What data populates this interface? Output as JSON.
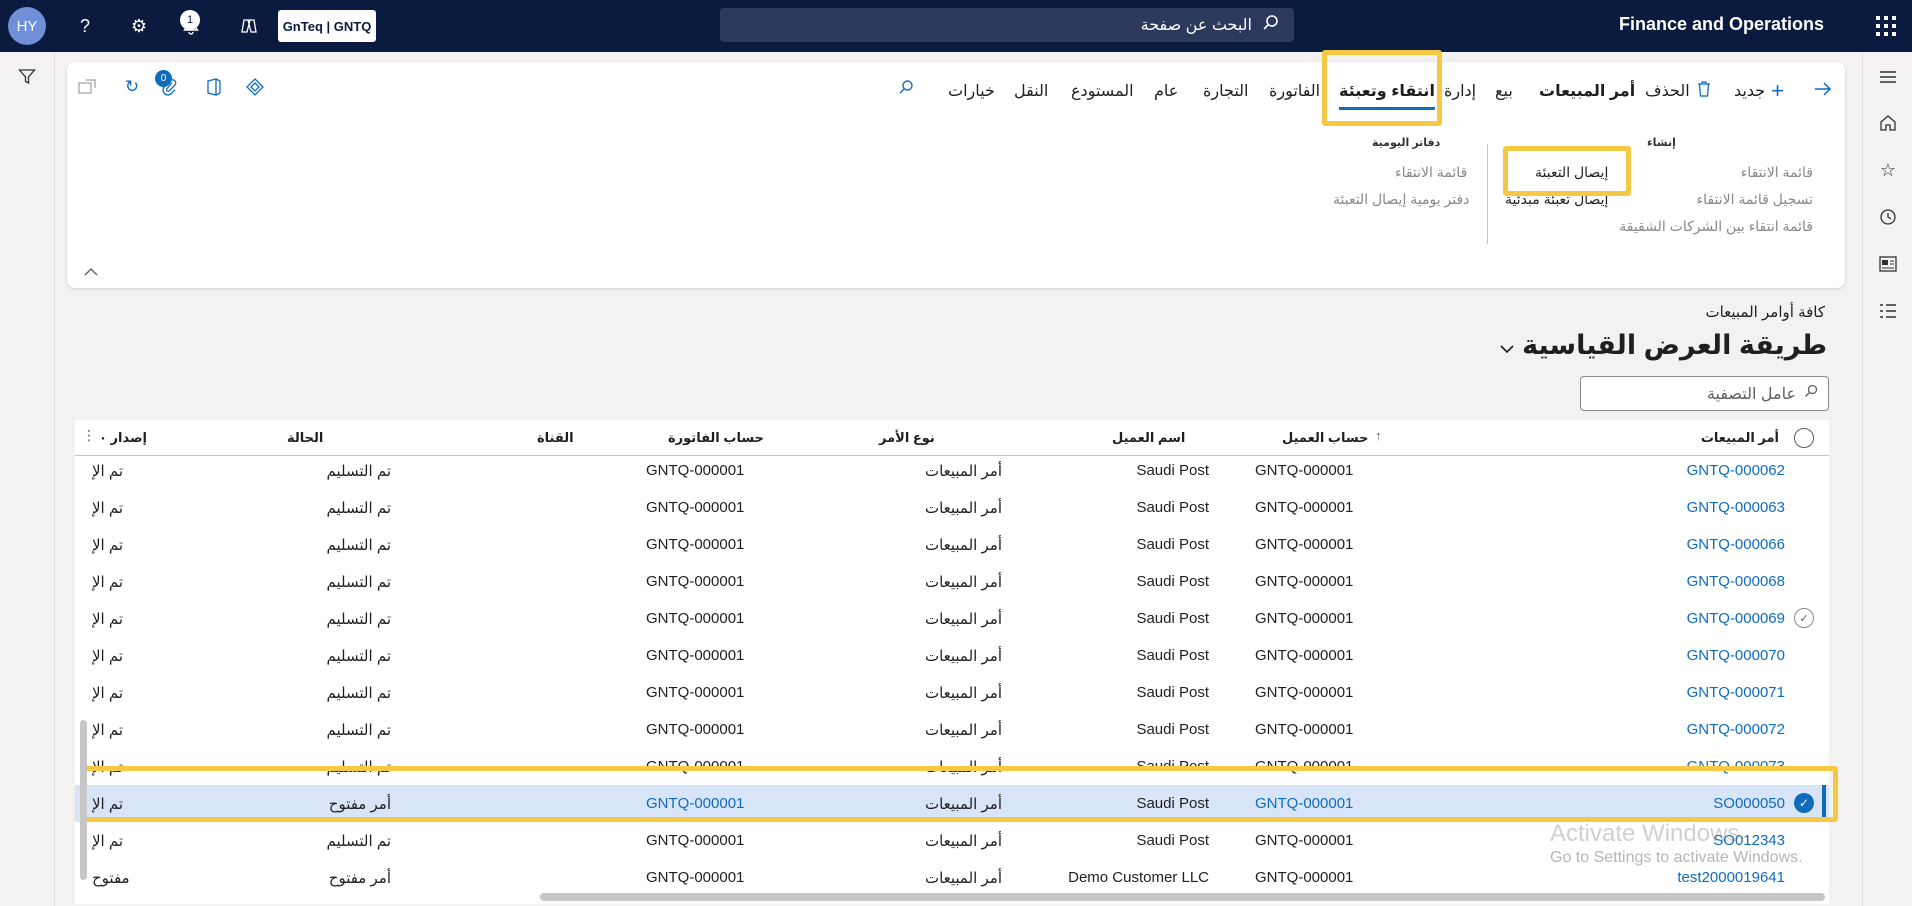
{
  "topbar": {
    "avatar_initials": "HY",
    "help_icon": "?",
    "notification_count": "1",
    "company": "GnTeq | GNTQ",
    "search_placeholder": "البحث عن صفحة",
    "app_title": "Finance and Operations"
  },
  "actionpane": {
    "new_label": "جديد",
    "delete_label": "الحذف",
    "attachments_count": "0",
    "tabs": [
      "أمر المبيعات",
      "بيع",
      "إدارة",
      "انتقاء وتعبئة",
      "الفاتورة",
      "التجارة",
      "عام",
      "المستودع",
      "النقل",
      "خيارات"
    ],
    "active_tab": "انتقاء وتعبئة",
    "groups": [
      {
        "title": "إنشاء",
        "items": [
          {
            "label": "قائمة الانتقاء",
            "enabled": false
          },
          {
            "label": "تسجيل قائمة الانتقاء",
            "enabled": false
          },
          {
            "label": "قائمة انتقاء بين الشركات الشقيقة",
            "enabled": false
          }
        ]
      },
      {
        "title": "",
        "items": [
          {
            "label": "إيصال التعبئة",
            "enabled": true
          },
          {
            "label": "إيصال تعبئة مبدئية",
            "enabled": true
          }
        ]
      },
      {
        "title": "دفاتر اليومية",
        "items": [
          {
            "label": "قائمة الانتقاء",
            "enabled": false
          },
          {
            "label": "دفتر يومية إيصال التعبئة",
            "enabled": false
          }
        ]
      }
    ]
  },
  "page": {
    "breadcrumb": "كافة أوامر المبيعات",
    "view_title": "طريقة العرض القياسية",
    "filter_placeholder": "عامل التصفية"
  },
  "grid": {
    "columns": [
      "أمر المبيعات",
      "حساب العميل",
      "اسم العميل",
      "نوع الأمر",
      "حساب الفاتورة",
      "القناة",
      "الحالة",
      "إصدار ٠"
    ],
    "rows": [
      {
        "order": "GNTQ-000062",
        "account": "GNTQ-000001",
        "name": "Saudi Post",
        "type": "أمر المبيعات",
        "invoice": "GNTQ-000001",
        "channel": "",
        "status": "تم التسليم",
        "release": "تم الإ"
      },
      {
        "order": "GNTQ-000063",
        "account": "GNTQ-000001",
        "name": "Saudi Post",
        "type": "أمر المبيعات",
        "invoice": "GNTQ-000001",
        "channel": "",
        "status": "تم التسليم",
        "release": "تم الإ"
      },
      {
        "order": "GNTQ-000066",
        "account": "GNTQ-000001",
        "name": "Saudi Post",
        "type": "أمر المبيعات",
        "invoice": "GNTQ-000001",
        "channel": "",
        "status": "تم التسليم",
        "release": "تم الإ"
      },
      {
        "order": "GNTQ-000068",
        "account": "GNTQ-000001",
        "name": "Saudi Post",
        "type": "أمر المبيعات",
        "invoice": "GNTQ-000001",
        "channel": "",
        "status": "تم التسليم",
        "release": "تم الإ"
      },
      {
        "order": "GNTQ-000069",
        "account": "GNTQ-000001",
        "name": "Saudi Post",
        "type": "أمر المبيعات",
        "invoice": "GNTQ-000001",
        "channel": "",
        "status": "تم التسليم",
        "release": "تم الإ"
      },
      {
        "order": "GNTQ-000070",
        "account": "GNTQ-000001",
        "name": "Saudi Post",
        "type": "أمر المبيعات",
        "invoice": "GNTQ-000001",
        "channel": "",
        "status": "تم التسليم",
        "release": "تم الإ"
      },
      {
        "order": "GNTQ-000071",
        "account": "GNTQ-000001",
        "name": "Saudi Post",
        "type": "أمر المبيعات",
        "invoice": "GNTQ-000001",
        "channel": "",
        "status": "تم التسليم",
        "release": "تم الإ"
      },
      {
        "order": "GNTQ-000072",
        "account": "GNTQ-000001",
        "name": "Saudi Post",
        "type": "أمر المبيعات",
        "invoice": "GNTQ-000001",
        "channel": "",
        "status": "تم التسليم",
        "release": "تم الإ"
      },
      {
        "order": "GNTQ-000073",
        "account": "GNTQ-000001",
        "name": "Saudi Post",
        "type": "أمر المبيعات",
        "invoice": "GNTQ-000001",
        "channel": "",
        "status": "تم التسليم",
        "release": "تم الإ"
      },
      {
        "order": "SO000050",
        "account": "GNTQ-000001",
        "name": "Saudi Post",
        "type": "أمر المبيعات",
        "invoice": "GNTQ-000001",
        "channel": "",
        "status": "أمر مفتوح",
        "release": "تم الإ"
      },
      {
        "order": "SO012343",
        "account": "GNTQ-000001",
        "name": "Saudi Post",
        "type": "أمر المبيعات",
        "invoice": "GNTQ-000001",
        "channel": "",
        "status": "تم التسليم",
        "release": "تم الإ"
      },
      {
        "order": "test2000019641",
        "account": "GNTQ-000001",
        "name": "Demo Customer LLC",
        "type": "أمر المبيعات",
        "invoice": "GNTQ-000001",
        "channel": "",
        "status": "أمر مفتوح",
        "release": "مفتوح"
      }
    ]
  },
  "watermark": {
    "line1": "Activate Windows",
    "line2": "Go to Settings to activate Windows."
  },
  "colors": {
    "topbar": "#0b1b3f",
    "accent": "#0f6cbd",
    "highlight": "#f6c945",
    "selected_row": "#d8e5f8"
  }
}
